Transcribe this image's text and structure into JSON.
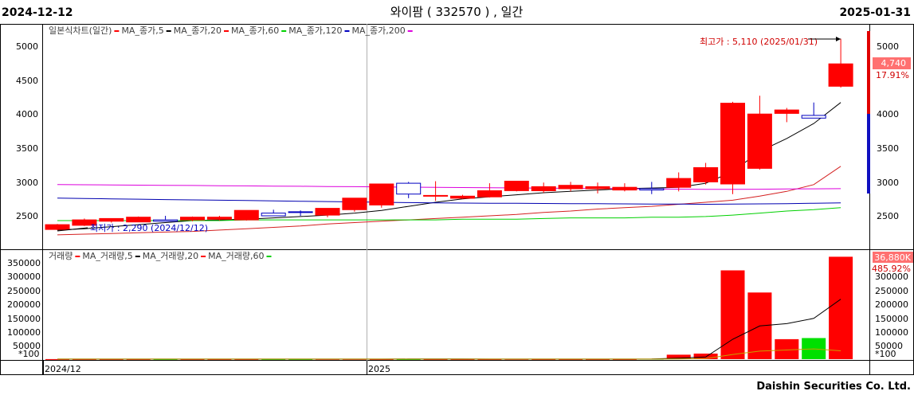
{
  "header": {
    "start_date": "2024-12-12",
    "title": "와이팜 ( 332570 ) , 일간",
    "end_date": "2025-01-31"
  },
  "footer": {
    "company": "Daishin Securities Co. Ltd."
  },
  "colors": {
    "up": "#ff0000",
    "down": "#0000c0",
    "ma5": "#000000",
    "ma20": "#d42020",
    "ma60": "#00d000",
    "ma120": "#0000b0",
    "ma200": "#dd00dd",
    "vol_down": "#00e000"
  },
  "price_panel": {
    "legend": [
      {
        "label": "일본식차트(일간)",
        "color": "#ff0000"
      },
      {
        "label": "MA_종가,5",
        "color": "#000000"
      },
      {
        "label": "MA_종가,20",
        "color": "#ff0000"
      },
      {
        "label": "MA_종가,60",
        "color": "#00d000"
      },
      {
        "label": "MA_종가,120",
        "color": "#0000c0"
      },
      {
        "label": "MA_종가,200",
        "color": "#dd00dd"
      }
    ],
    "y_ticks": [
      "5000",
      "4500",
      "4000",
      "3500",
      "3000",
      "2500"
    ],
    "annotation_high": "최고가 : 5,110 (2025/01/31)",
    "annotation_low": "최저가 : 2,290 (2024/12/12)",
    "last_price": "4,740",
    "change_pct": "17.91%"
  },
  "volume_panel": {
    "legend": [
      {
        "label": "거래량",
        "color": "#ff0000"
      },
      {
        "label": "MA_거래량,5",
        "color": "#000000"
      },
      {
        "label": "MA_거래량,20",
        "color": "#ff0000"
      },
      {
        "label": "MA_거래량,60",
        "color": "#00d000"
      }
    ],
    "y_ticks": [
      "350000",
      "300000",
      "250000",
      "200000",
      "150000",
      "100000",
      "50000"
    ],
    "unit": "*100",
    "last_volume": "36,880K",
    "change_pct": "485.92%"
  },
  "x_labels": [
    "2024/12",
    "2025"
  ],
  "chart_data": [
    {
      "type": "candlestick",
      "title": "와이팜 ( 332570 ) , 일간",
      "ylim": [
        2150,
        5300
      ],
      "dates": [
        "2024-12-12",
        "2024-12-13",
        "2024-12-16",
        "2024-12-17",
        "2024-12-18",
        "2024-12-19",
        "2024-12-20",
        "2024-12-23",
        "2024-12-24",
        "2024-12-26",
        "2024-12-27",
        "2024-12-30",
        "2025-01-02",
        "2025-01-03",
        "2025-01-06",
        "2025-01-07",
        "2025-01-08",
        "2025-01-09",
        "2025-01-10",
        "2025-01-13",
        "2025-01-14",
        "2025-01-15",
        "2025-01-16",
        "2025-01-17",
        "2025-01-20",
        "2025-01-21",
        "2025-01-22",
        "2025-01-23",
        "2025-01-24",
        "2025-01-31"
      ],
      "open": [
        2300,
        2360,
        2420,
        2410,
        2440,
        2440,
        2450,
        2440,
        2540,
        2560,
        2510,
        2590,
        2660,
        2980,
        2800,
        2760,
        2780,
        2870,
        2870,
        2900,
        2900,
        2880,
        2900,
        2920,
        3000,
        2970,
        3200,
        4010,
        3980,
        4410
      ],
      "high": [
        2380,
        2460,
        2460,
        2490,
        2500,
        2490,
        2500,
        2580,
        2590,
        2580,
        2610,
        2730,
        2790,
        3000,
        3010,
        2810,
        2980,
        3010,
        2990,
        3000,
        2990,
        2980,
        3000,
        3140,
        3280,
        4180,
        4270,
        4090,
        4170,
        5110
      ],
      "low": [
        2290,
        2350,
        2400,
        2410,
        2420,
        2420,
        2430,
        2430,
        2500,
        2500,
        2480,
        2560,
        2620,
        2760,
        2720,
        2750,
        2770,
        2860,
        2840,
        2860,
        2830,
        2860,
        2820,
        2860,
        2960,
        2820,
        3180,
        3880,
        3960,
        4390
      ],
      "close": [
        2370,
        2440,
        2460,
        2480,
        2420,
        2480,
        2480,
        2580,
        2500,
        2550,
        2610,
        2760,
        2970,
        2820,
        2800,
        2790,
        2870,
        3010,
        2930,
        2950,
        2930,
        2920,
        2880,
        3050,
        3210,
        4160,
        4000,
        4060,
        3940,
        4740
      ],
      "ma": [
        {
          "name": "MA_종가,5",
          "values": [
            2290,
            2310,
            2340,
            2370,
            2400,
            2430,
            2440,
            2450,
            2470,
            2490,
            2510,
            2540,
            2580,
            2640,
            2700,
            2750,
            2780,
            2810,
            2840,
            2860,
            2880,
            2900,
            2910,
            2920,
            2980,
            3150,
            3450,
            3640,
            3860,
            4170
          ]
        },
        {
          "name": "MA_종가,20",
          "values": [
            2220,
            2230,
            2240,
            2250,
            2260,
            2270,
            2290,
            2310,
            2330,
            2350,
            2380,
            2400,
            2420,
            2440,
            2460,
            2480,
            2500,
            2520,
            2550,
            2570,
            2600,
            2620,
            2640,
            2670,
            2700,
            2730,
            2790,
            2860,
            2960,
            3230
          ]
        },
        {
          "name": "MA_종가,60",
          "values": [
            2430,
            2430,
            2430,
            2430,
            2430,
            2430,
            2430,
            2440,
            2440,
            2440,
            2440,
            2440,
            2440,
            2440,
            2440,
            2450,
            2450,
            2450,
            2460,
            2470,
            2470,
            2470,
            2480,
            2480,
            2490,
            2510,
            2540,
            2570,
            2590,
            2620
          ]
        },
        {
          "name": "MA_종가,120",
          "values": [
            2760,
            2755,
            2750,
            2745,
            2740,
            2735,
            2730,
            2725,
            2720,
            2715,
            2710,
            2705,
            2700,
            2695,
            2690,
            2688,
            2686,
            2684,
            2682,
            2680,
            2678,
            2676,
            2674,
            2672,
            2670,
            2672,
            2676,
            2680,
            2685,
            2690
          ]
        },
        {
          "name": "MA_종가,200",
          "values": [
            2960,
            2958,
            2955,
            2952,
            2950,
            2947,
            2944,
            2941,
            2938,
            2935,
            2932,
            2929,
            2926,
            2923,
            2920,
            2917,
            2914,
            2911,
            2908,
            2905,
            2902,
            2899,
            2896,
            2893,
            2890,
            2890,
            2892,
            2895,
            2898,
            2900
          ]
        }
      ]
    },
    {
      "type": "bar",
      "title": "거래량",
      "unit": "*100",
      "ylim": [
        0,
        380000
      ],
      "values": [
        300,
        200,
        200,
        200,
        300,
        200,
        200,
        300,
        200,
        200,
        200,
        500,
        700,
        400,
        300,
        300,
        200,
        200,
        600,
        300,
        200,
        200,
        300,
        1500,
        16000,
        20000,
        320000,
        240000,
        72000,
        76000,
        368800
      ],
      "ma": [
        {
          "name": "MA_거래량,5",
          "values": [
            300,
            260,
            240,
            230,
            240,
            220,
            220,
            240,
            240,
            220,
            220,
            300,
            360,
            400,
            440,
            440,
            440,
            320,
            320,
            300,
            280,
            240,
            300,
            500,
            3800,
            7800,
            71600,
            119600,
            128000,
            147000,
            216000
          ]
        },
        {
          "name": "MA_거래량,20",
          "values": [
            280,
            275,
            270,
            265,
            260,
            255,
            255,
            255,
            255,
            260,
            260,
            265,
            270,
            275,
            280,
            285,
            290,
            295,
            300,
            305,
            310,
            315,
            320,
            380,
            1000,
            2000,
            17000,
            29000,
            33000,
            37000,
            30000
          ]
        }
      ]
    }
  ]
}
